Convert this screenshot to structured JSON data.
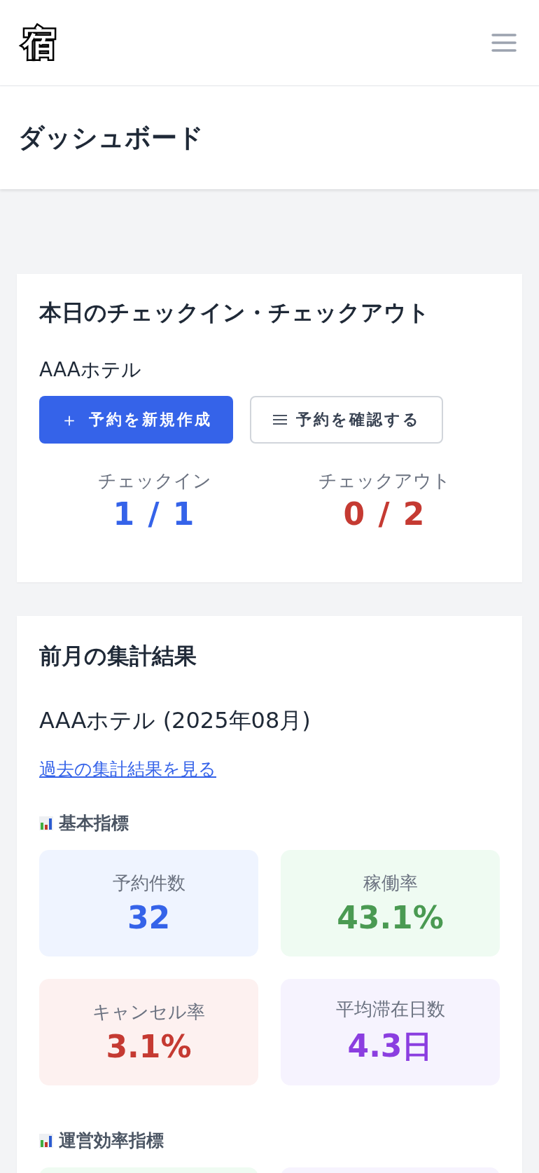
{
  "header": {
    "logo": "宿"
  },
  "page_title": "ダッシュボード",
  "today": {
    "title": "本日のチェックイン・チェックアウト",
    "hotel": "AAAホテル",
    "buttons": [
      {
        "kind": "primary",
        "icon": "＋",
        "label": "予約を新規作成"
      },
      {
        "kind": "secondary",
        "label": "予約を確認する"
      }
    ],
    "counts": [
      {
        "label": "チェックイン",
        "value": "1 / 1",
        "kind": "in"
      },
      {
        "label": "チェックアウト",
        "value": "0 / 2",
        "kind": "out"
      }
    ]
  },
  "summary": {
    "title": "前月の集計結果",
    "hotel": "AAAホテル (2025年08月)",
    "link": "過去の集計結果を見る",
    "sections": [
      {
        "heading": "基本指標",
        "metrics": [
          {
            "label": "予約件数",
            "value": "32",
            "kind": "blue"
          },
          {
            "label": "稼働率",
            "value": "43.1%",
            "kind": "green"
          },
          {
            "label": "キャンセル率",
            "value": "3.1%",
            "kind": "red"
          },
          {
            "label": "平均滞在日数",
            "value": "4.3日",
            "kind": "purple"
          }
        ]
      },
      {
        "heading": "運営効率指標",
        "metrics": [
          {
            "kind": "green"
          },
          {
            "kind": "purple"
          }
        ]
      }
    ]
  }
}
